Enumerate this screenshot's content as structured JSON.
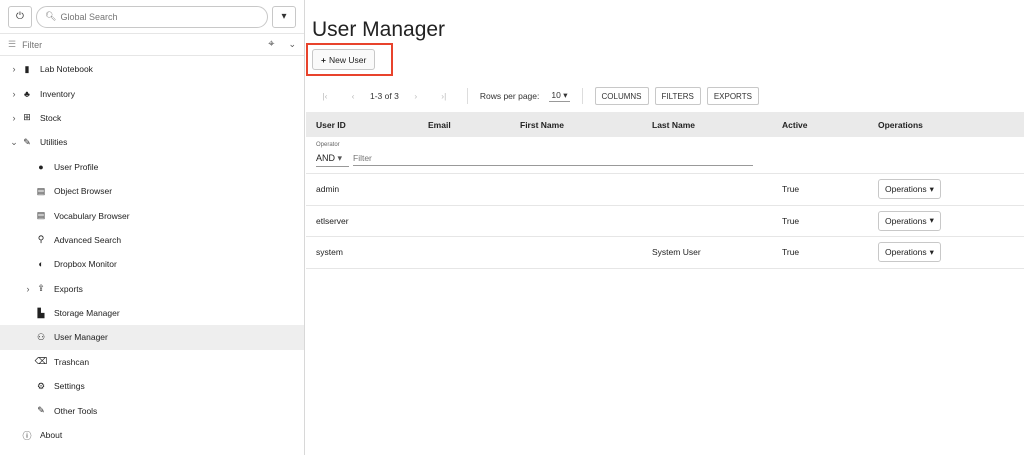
{
  "sidebar": {
    "search_placeholder": "Global Search",
    "filter_placeholder": "Filter",
    "items": [
      {
        "label": "Lab Notebook"
      },
      {
        "label": "Inventory"
      },
      {
        "label": "Stock"
      },
      {
        "label": "Utilities"
      },
      {
        "label": "User Profile"
      },
      {
        "label": "Object Browser"
      },
      {
        "label": "Vocabulary Browser"
      },
      {
        "label": "Advanced Search"
      },
      {
        "label": "Dropbox Monitor"
      },
      {
        "label": "Exports"
      },
      {
        "label": "Storage Manager"
      },
      {
        "label": "User Manager"
      },
      {
        "label": "Trashcan"
      },
      {
        "label": "Settings"
      },
      {
        "label": "Other Tools"
      },
      {
        "label": "About"
      }
    ]
  },
  "main": {
    "title": "User Manager",
    "new_user_label": "New User",
    "pagination": {
      "range": "1-3 of 3",
      "rows_per_page_label": "Rows per page:",
      "rows_per_page": "10"
    },
    "toolbar": {
      "columns": "COLUMNS",
      "filters": "FILTERS",
      "exports": "EXPORTS"
    },
    "columns": [
      "User ID",
      "Email",
      "First Name",
      "Last Name",
      "Active",
      "Operations"
    ],
    "filter": {
      "operator_label": "Operator",
      "operator_value": "AND",
      "placeholder": "Filter"
    },
    "rows": [
      {
        "user_id": "admin",
        "email": "",
        "first_name": "",
        "last_name": "",
        "active": "True",
        "operations": "Operations"
      },
      {
        "user_id": "etlserver",
        "email": "",
        "first_name": "",
        "last_name": "",
        "active": "True",
        "operations": "Operations"
      },
      {
        "user_id": "system",
        "email": "",
        "first_name": "",
        "last_name": "System User",
        "active": "True",
        "operations": "Operations"
      }
    ]
  },
  "colors": {
    "highlight": "#e8432c",
    "header_bg": "#eaeaea",
    "active_item_bg": "#eeeeee"
  }
}
